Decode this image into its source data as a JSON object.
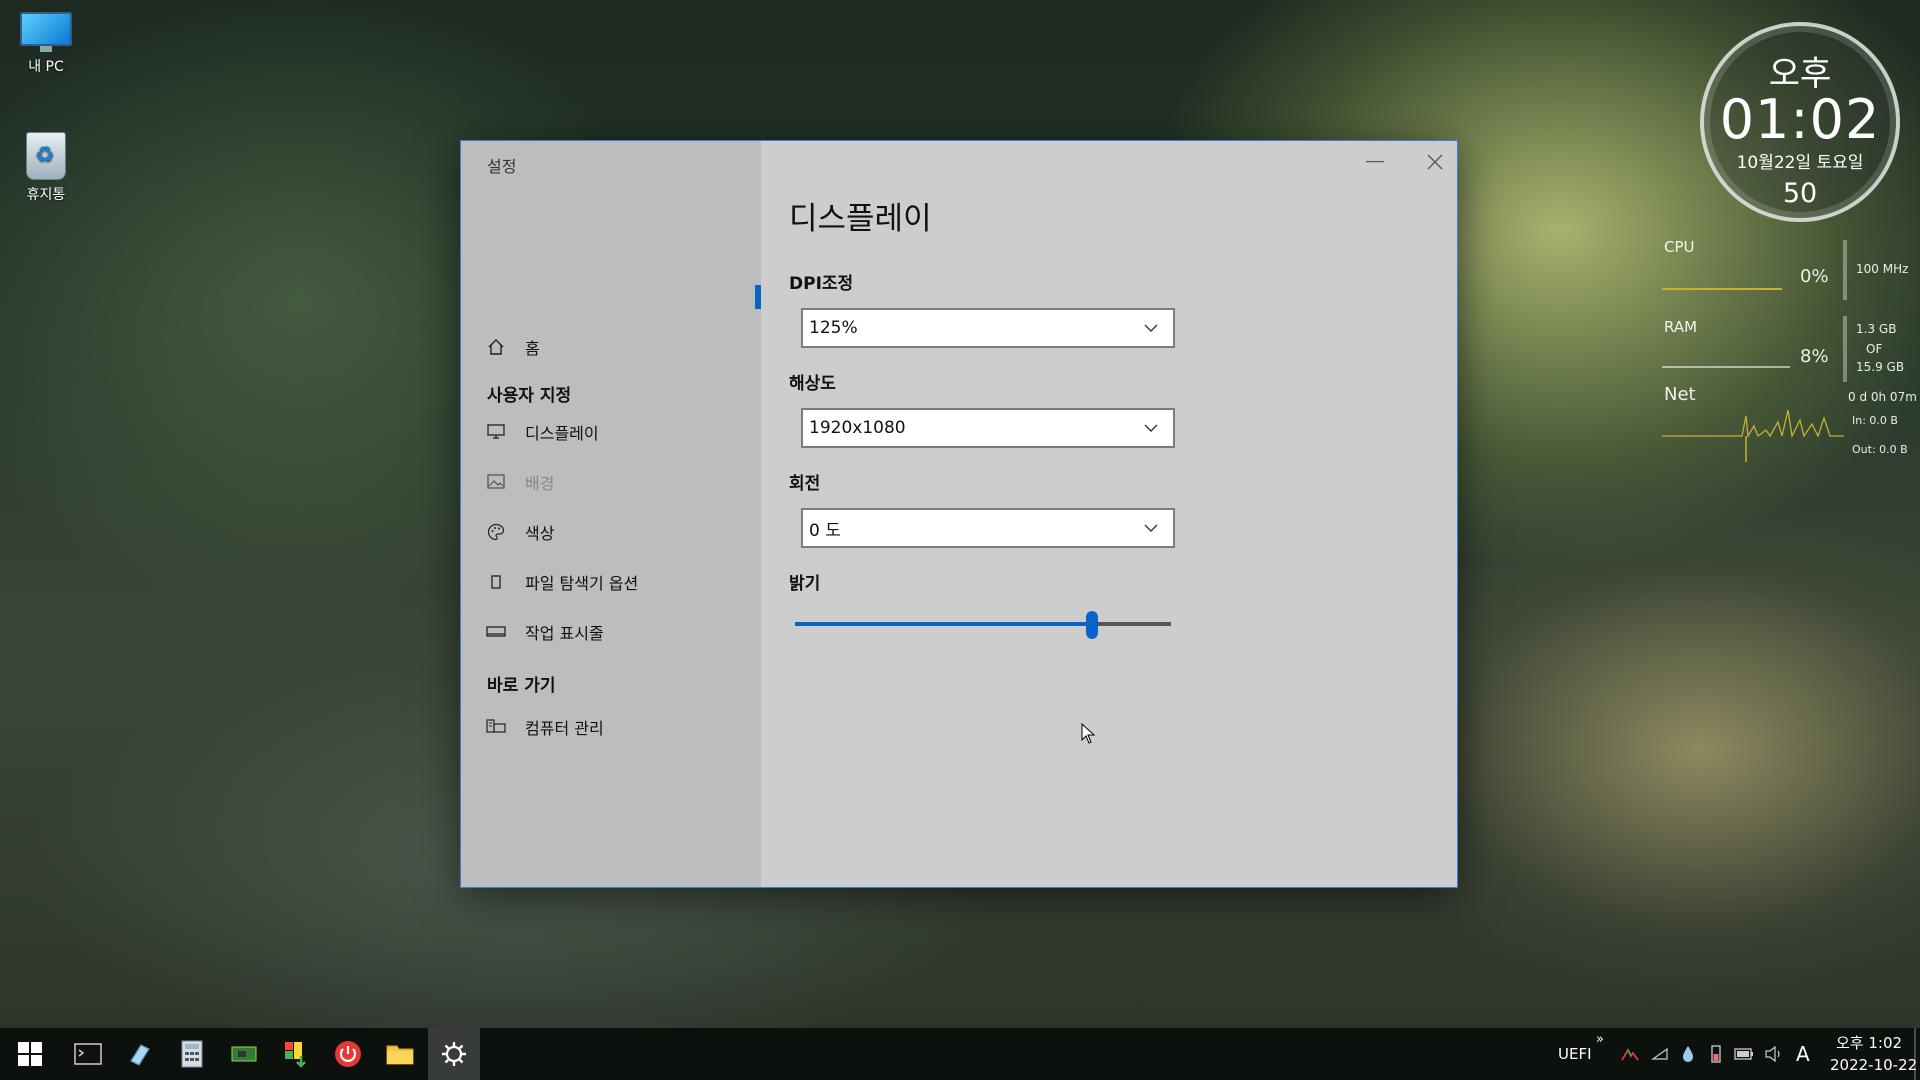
{
  "desktop": {
    "icons": [
      {
        "label": "내 PC"
      },
      {
        "label": "휴지통"
      }
    ]
  },
  "window": {
    "title": "설정",
    "sidebar": {
      "home": "홈",
      "section_custom": "사용자 지정",
      "items": [
        {
          "label": "디스플레이",
          "icon": "monitor-icon",
          "active": true
        },
        {
          "label": "배경",
          "icon": "picture-icon",
          "disabled": true
        },
        {
          "label": "색상",
          "icon": "palette-icon"
        },
        {
          "label": "파일 탐색기 옵션",
          "icon": "file-icon"
        },
        {
          "label": "작업 표시줄",
          "icon": "taskbar-icon"
        }
      ],
      "section_shortcuts": "바로 가기",
      "shortcut_items": [
        {
          "label": "컴퓨터 관리",
          "icon": "computer-management-icon"
        }
      ]
    },
    "content": {
      "title": "디스플레이",
      "dpi": {
        "label": "DPI조정",
        "value": "125%"
      },
      "resolution": {
        "label": "해상도",
        "value": "1920x1080"
      },
      "rotation": {
        "label": "회전",
        "value": "0 도"
      },
      "brightness": {
        "label": "밝기",
        "level_percent": 79
      }
    },
    "accent_color": "#0a64c8"
  },
  "gadgets": {
    "clock": {
      "ampm": "오후",
      "time": "01:02",
      "date": "10월22일 토요일",
      "seconds": "50"
    },
    "system": {
      "cpu_label": "CPU",
      "cpu_percent": "0%",
      "cpu_freq": "100 MHz",
      "ram_label": "RAM",
      "ram_percent": "8%",
      "ram_used": "1.3 GB",
      "ram_of": "OF",
      "ram_total": "15.9 GB",
      "net_label": "Net",
      "uptime": "0 d 0h 07m",
      "net_in": "In: 0.0 B",
      "net_out": "Out: 0.0 B"
    }
  },
  "taskbar": {
    "apps": [
      "start-icon",
      "terminal-icon",
      "eraser-icon",
      "calculator-icon",
      "hardware-icon",
      "installer-icon",
      "power-icon",
      "folder-icon",
      "settings-icon"
    ],
    "tray": {
      "uefi": "UEFI",
      "overflow": "»",
      "ime": "A",
      "ampm_time": "오후 1:02",
      "date": "2022-10-22"
    }
  }
}
